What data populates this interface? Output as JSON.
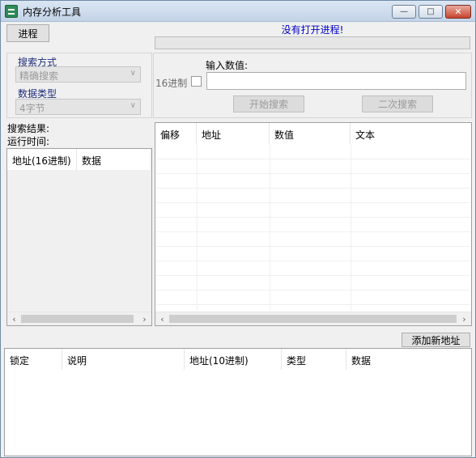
{
  "window": {
    "title": "内存分析工具",
    "minimize_glyph": "—",
    "maximize_glyph": "□",
    "close_glyph": "✕"
  },
  "process_button": "进程",
  "status_text": "没有打开进程!",
  "search_panel": {
    "mode_label": "搜索方式",
    "mode_value": "精确搜索",
    "type_label": "数据类型",
    "type_value": "4字节"
  },
  "input_panel": {
    "input_label": "输入数值:",
    "hex_label": "16进制",
    "value": "",
    "start_search": "开始搜索",
    "second_search": "二次搜索"
  },
  "results": {
    "result_label": "搜索结果:",
    "time_label": "运行时间:",
    "columns": [
      "地址(16进制)",
      "数据"
    ]
  },
  "memory_view": {
    "columns": [
      "偏移",
      "地址",
      "数值",
      "文本"
    ]
  },
  "add_address_button": "添加新地址",
  "saved_list": {
    "columns": [
      "锁定",
      "说明",
      "地址(10进制)",
      "类型",
      "数据"
    ]
  },
  "icons": {
    "app": "app-icon",
    "scroll_left": "chevron-left-icon",
    "scroll_right": "chevron-right-icon",
    "dropdown": "chevron-down-icon"
  }
}
